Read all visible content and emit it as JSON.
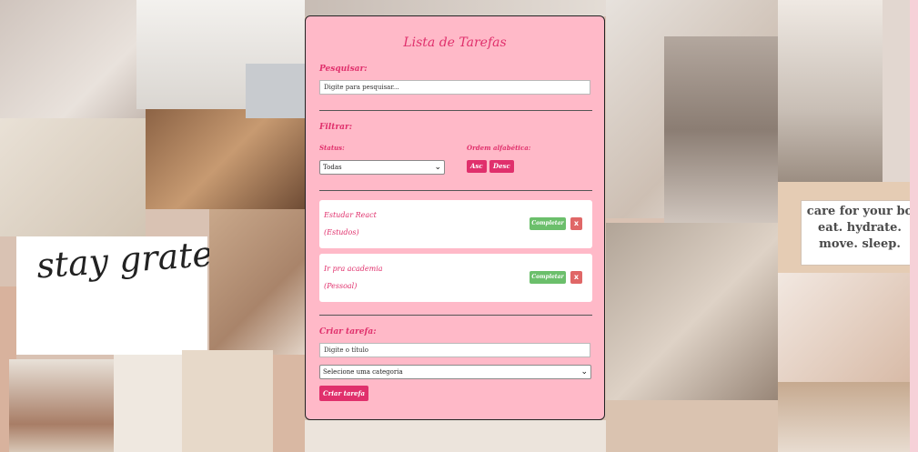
{
  "background": {
    "collage_text": "stay grateful",
    "poster_lines": [
      "care for your bo",
      "eat. hydrate.",
      "move. sleep."
    ]
  },
  "app": {
    "title": "Lista de Tarefas",
    "search": {
      "label": "Pesquisar:",
      "placeholder": "Digite para pesquisar..."
    },
    "filter": {
      "label": "Filtrar:",
      "status_label": "Status:",
      "status_selected": "Todas",
      "sort_label": "Ordem alfabética:",
      "asc_label": "Asc",
      "desc_label": "Desc"
    },
    "tasks": [
      {
        "name": "Estudar React",
        "category": "(Estudos)",
        "complete_label": "Completar",
        "delete_label": "x"
      },
      {
        "name": "Ir pra academia",
        "category": "(Pessoal)",
        "complete_label": "Completar",
        "delete_label": "x"
      }
    ],
    "create": {
      "label": "Criar tarefa:",
      "title_placeholder": "Digite o título",
      "category_selected": "Selecione uma categoria",
      "submit_label": "Criar tarefa"
    }
  },
  "colors": {
    "card_bg": "#ffb9c8",
    "accent": "#e0306c",
    "complete": "#6bbf6b",
    "delete": "#e06767"
  }
}
